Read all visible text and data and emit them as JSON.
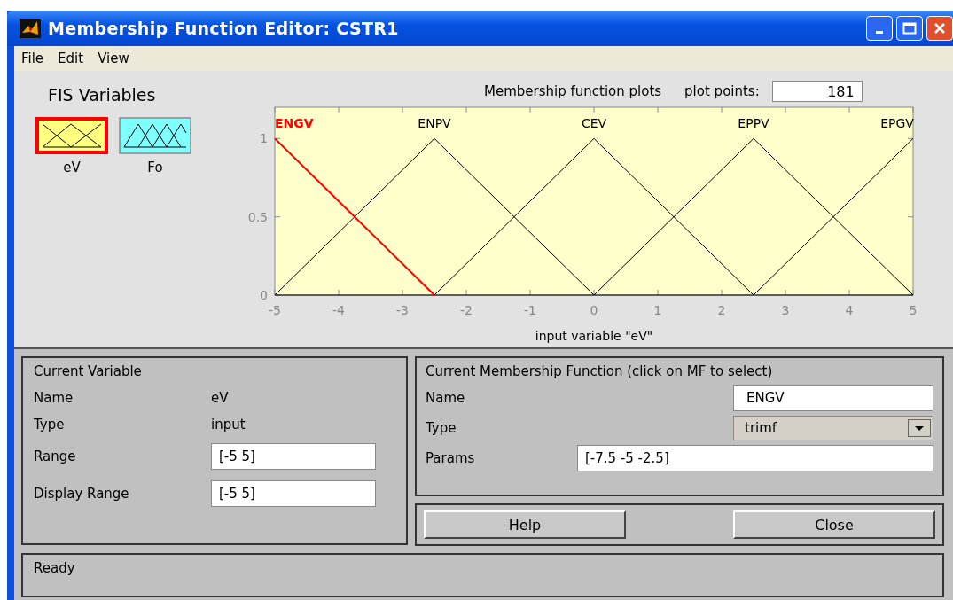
{
  "window": {
    "title": "Membership Function Editor: CSTR1"
  },
  "menu": [
    "File",
    "Edit",
    "View"
  ],
  "fis_variables": {
    "title": "FIS Variables",
    "items": [
      {
        "label": "eV",
        "kind": "input",
        "selected": true
      },
      {
        "label": "Fo",
        "kind": "output",
        "selected": false
      }
    ]
  },
  "plot": {
    "title": "Membership function plots",
    "plot_points_label": "plot points:",
    "plot_points": "181",
    "chart_data": {
      "type": "line",
      "xlabel": "input variable \"eV\"",
      "x": [
        -5,
        -2.5,
        0,
        2.5,
        5
      ],
      "xlim": [
        -5,
        5
      ],
      "ylim": [
        0,
        1.2
      ],
      "xticks": [
        -5,
        -4,
        -3,
        -2,
        -1,
        0,
        1,
        2,
        3,
        4,
        5
      ],
      "yticks": [
        0,
        0.5,
        1
      ],
      "series": [
        {
          "name": "ENGV",
          "color": "#ff0000",
          "values": [
            1,
            0,
            null,
            null,
            null
          ]
        },
        {
          "name": "ENPV",
          "color": "#000000",
          "values": [
            0,
            1,
            0,
            null,
            null
          ]
        },
        {
          "name": "CEV",
          "color": "#000000",
          "values": [
            null,
            0,
            1,
            0,
            null
          ]
        },
        {
          "name": "EPPV",
          "color": "#000000",
          "values": [
            null,
            null,
            0,
            1,
            0
          ]
        },
        {
          "name": "EPGV",
          "color": "#000000",
          "values": [
            null,
            null,
            null,
            0,
            1
          ]
        }
      ]
    }
  },
  "current_variable": {
    "title": "Current Variable",
    "name_label": "Name",
    "name": "eV",
    "type_label": "Type",
    "type": "input",
    "range_label": "Range",
    "range": "[-5 5]",
    "display_range_label": "Display Range",
    "display_range": "[-5 5]"
  },
  "current_mf": {
    "title": "Current Membership Function (click on MF to select)",
    "name_label": "Name",
    "name": "ENGV",
    "type_label": "Type",
    "type": "trimf",
    "params_label": "Params",
    "params": "[-7.5 -5 -2.5]"
  },
  "buttons": [
    "Help",
    "Close"
  ],
  "status_bar": "Ready"
}
